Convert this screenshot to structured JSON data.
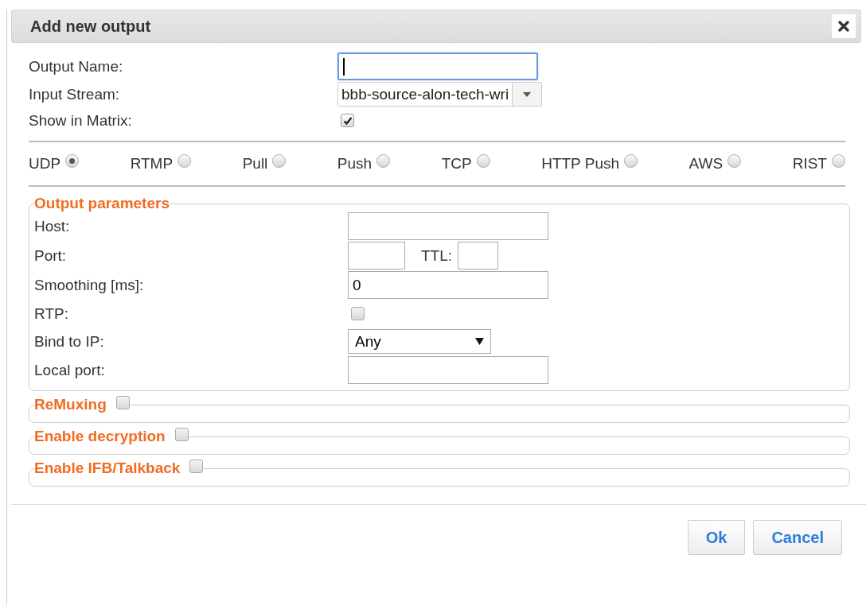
{
  "dialog": {
    "title": "Add new output"
  },
  "general_fields": [
    {
      "kind": "text",
      "label": "Output Name:",
      "focused": true
    },
    {
      "kind": "select",
      "label": "Input Stream:",
      "value": "bbb-source-alon-tech-wri"
    },
    {
      "kind": "checkbox",
      "label": "Show in Matrix:",
      "checked": true
    }
  ],
  "protocols": [
    {
      "label": "UDP",
      "selected": true
    },
    {
      "label": "RTMP",
      "selected": false
    },
    {
      "label": "Pull",
      "selected": false
    },
    {
      "label": "Push",
      "selected": false
    },
    {
      "label": "TCP",
      "selected": false
    },
    {
      "label": "HTTP Push",
      "selected": false
    },
    {
      "label": "AWS",
      "selected": false
    },
    {
      "label": "RIST",
      "selected": false
    }
  ],
  "output_parameters": {
    "title": "Output parameters",
    "fields": [
      {
        "kind": "text",
        "label": "Host:"
      },
      {
        "kind": "port_ttl",
        "label": "Port:",
        "ttl_label": "TTL:"
      },
      {
        "kind": "text",
        "label": "Smoothing [ms]:",
        "value": "0"
      },
      {
        "kind": "checkbox",
        "label": "RTP:",
        "checked": false
      },
      {
        "kind": "select",
        "label": "Bind to IP:",
        "value": "Any"
      },
      {
        "kind": "text",
        "label": "Local port:"
      }
    ]
  },
  "sections": [
    {
      "title": "ReMuxing",
      "checked": false
    },
    {
      "title": "Enable decryption",
      "checked": false
    },
    {
      "title": "Enable IFB/Talkback",
      "checked": false
    }
  ],
  "buttons": [
    "Ok",
    "Cancel"
  ]
}
